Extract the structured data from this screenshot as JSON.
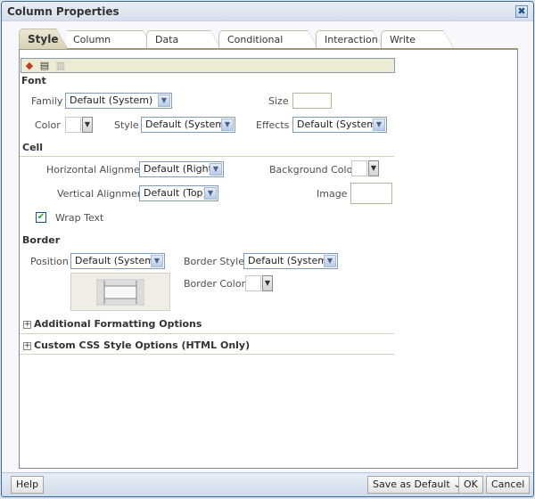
{
  "dialog": {
    "title": "Column Properties",
    "close_icon": "close-icon"
  },
  "tabs": [
    {
      "label": "Style",
      "active": true
    },
    {
      "label": "Column Format",
      "active": false
    },
    {
      "label": "Data Format",
      "active": false
    },
    {
      "label": "Conditional Format",
      "active": false
    },
    {
      "label": "Interaction",
      "active": false
    },
    {
      "label": "Write Back",
      "active": false
    }
  ],
  "toolbar": {
    "icons": [
      "eraser-icon",
      "copy-icon",
      "paste-icon"
    ],
    "glyphs": [
      "◆",
      "▤",
      "▥"
    ]
  },
  "font": {
    "section_title": "Font",
    "family_label": "Family",
    "family_value": "Default (System)",
    "size_label": "Size",
    "size_value": "",
    "color_label": "Color",
    "style_label": "Style",
    "style_value": "Default (System)",
    "effects_label": "Effects",
    "effects_value": "Default (System)"
  },
  "cell": {
    "section_title": "Cell",
    "h_align_label": "Horizontal Alignment",
    "h_align_value": "Default (Right)",
    "bg_color_label": "Background Color",
    "v_align_label": "Vertical Alignment",
    "v_align_value": "Default (Top)",
    "image_label": "Image",
    "wrap_text_label": "Wrap Text",
    "wrap_text_checked": true
  },
  "border": {
    "section_title": "Border",
    "position_label": "Position",
    "position_value": "Default (System)",
    "style_label": "Border Style",
    "style_value": "Default (System)",
    "color_label": "Border Color"
  },
  "expanders": [
    {
      "label": "Additional Formatting Options",
      "symbol": "+"
    },
    {
      "label": "Custom CSS Style Options (HTML Only)",
      "symbol": "+"
    }
  ],
  "footer": {
    "help_label": "Help",
    "save_default_label": "Save as Default ⌄",
    "ok_label": "OK",
    "cancel_label": "Cancel"
  },
  "symbols": {
    "dropdown_arrow": "▼",
    "checkmark": "✔",
    "close": "✖"
  }
}
